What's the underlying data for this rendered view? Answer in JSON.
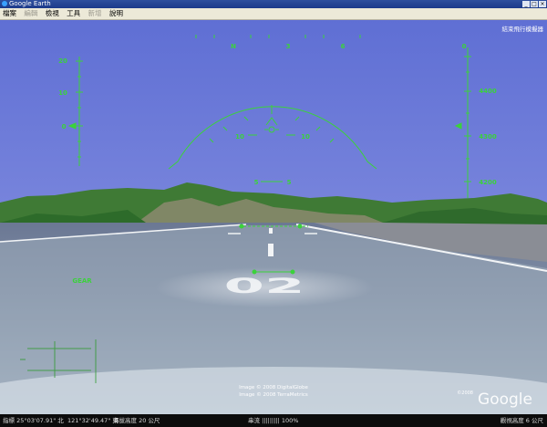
{
  "window": {
    "title": "Google Earth",
    "buttons": [
      "_",
      "□",
      "×"
    ]
  },
  "menu": [
    {
      "label": "檔案",
      "enabled": true
    },
    {
      "label": "編輯",
      "enabled": false
    },
    {
      "label": "檢視",
      "enabled": true
    },
    {
      "label": "工具",
      "enabled": true
    },
    {
      "label": "新增",
      "enabled": false
    },
    {
      "label": "說明",
      "enabled": true
    }
  ],
  "hud": {
    "exit_label": "結束飛行模擬器",
    "heading_labels": [
      "N",
      "3",
      "6"
    ],
    "speed_ticks": [
      "20",
      "10",
      "0"
    ],
    "altitude_ticks": [
      "0",
      "4400",
      "4300",
      "4200"
    ],
    "pitch_labels": [
      "10",
      "10",
      "5",
      "5"
    ],
    "gear_label": "GEAR",
    "color": "#3bd23b"
  },
  "scene": {
    "runway_number": "02",
    "sky_color": "#6b79d8",
    "attribution": [
      "Image © 2008 DigitalGlobe",
      "Image © 2008 TerraMetrics"
    ],
    "copyright_small": "©2008",
    "logo": "Google"
  },
  "status": {
    "left": "指標 25°03'07.91\" 北",
    "lat": "121°32'49.47\" 東",
    "elev": "海拔高度 20 公尺",
    "stream": "串流 ||||||||| 100%",
    "eye": "觀視高度 6 公尺"
  }
}
